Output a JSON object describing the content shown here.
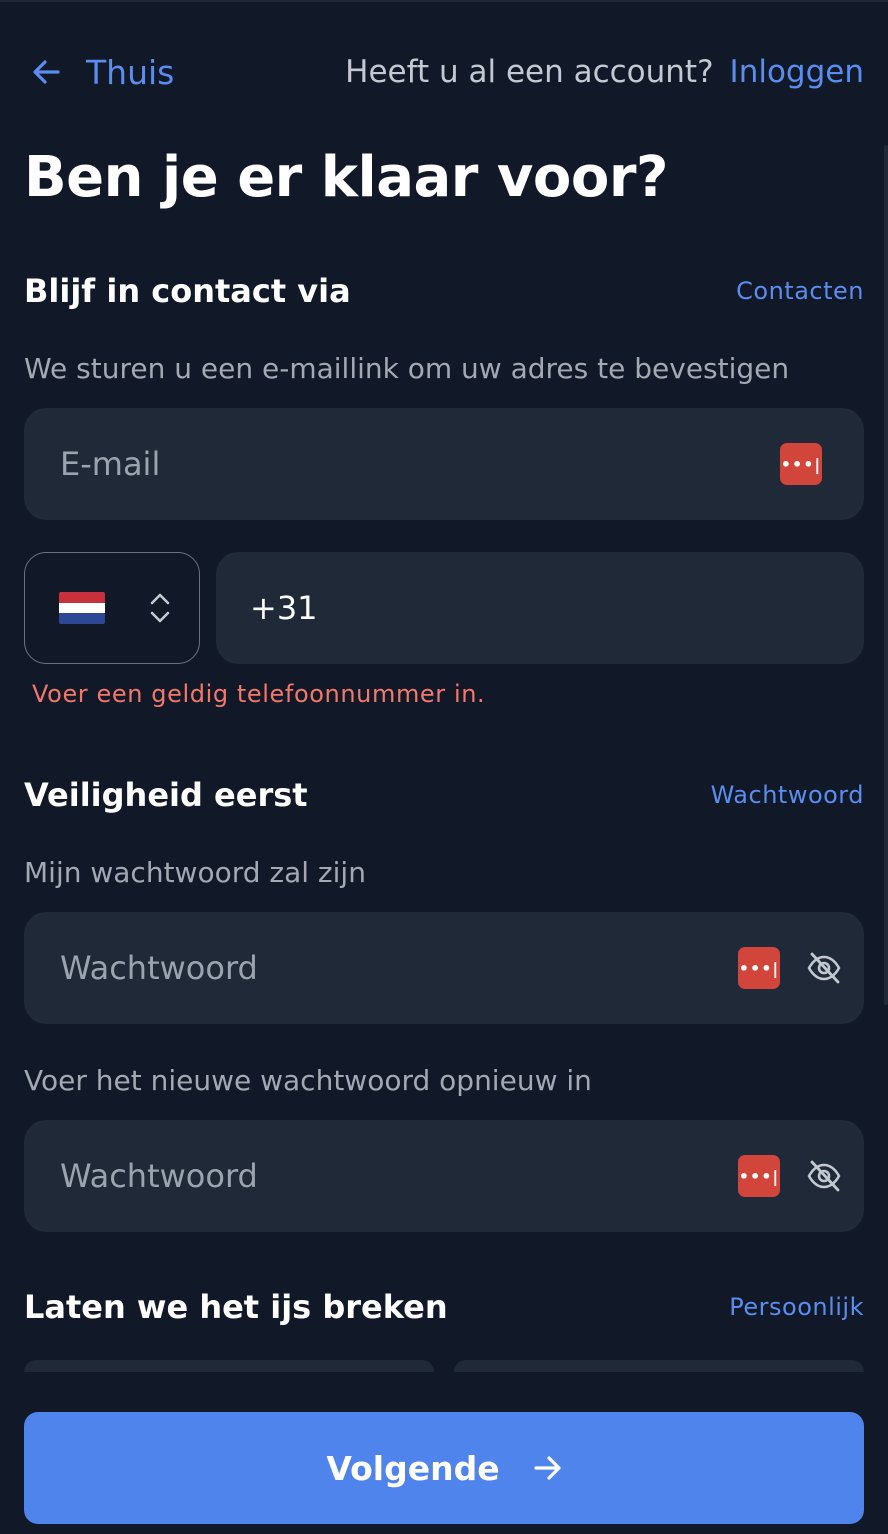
{
  "header": {
    "back_label": "Thuis",
    "account_question": "Heeft u al een account?",
    "login_link": "Inloggen"
  },
  "title": "Ben je er klaar voor?",
  "contact": {
    "heading": "Blijf in contact via",
    "tag": "Contacten",
    "hint": "We sturen u een e-maillink om uw adres te bevestigen",
    "email_placeholder": "E-mail",
    "country_flag": "Netherlands",
    "phone_value": "+31",
    "phone_error": "Voer een geldig telefoonnummer in."
  },
  "security": {
    "heading": "Veiligheid eerst",
    "tag": "Wachtwoord",
    "password_label": "Mijn wachtwoord zal zijn",
    "password_placeholder": "Wachtwoord",
    "confirm_label": "Voer het nieuwe wachtwoord opnieuw in",
    "confirm_placeholder": "Wachtwoord"
  },
  "personal": {
    "heading": "Laten we het ijs breken",
    "tag": "Persoonlijk"
  },
  "footer": {
    "next_label": "Volgende"
  },
  "icons": {
    "back": "arrow-left-icon",
    "password_manager": "password-manager-icon",
    "visibility": "eye-off-icon",
    "stepper": "chevron-up-down-icon",
    "next": "arrow-right-icon"
  },
  "colors": {
    "background": "#111827",
    "field": "#1f2937",
    "accent": "#4f84ec",
    "link": "#5b8def",
    "error": "#f0796b",
    "password_manager": "#d1453b"
  }
}
